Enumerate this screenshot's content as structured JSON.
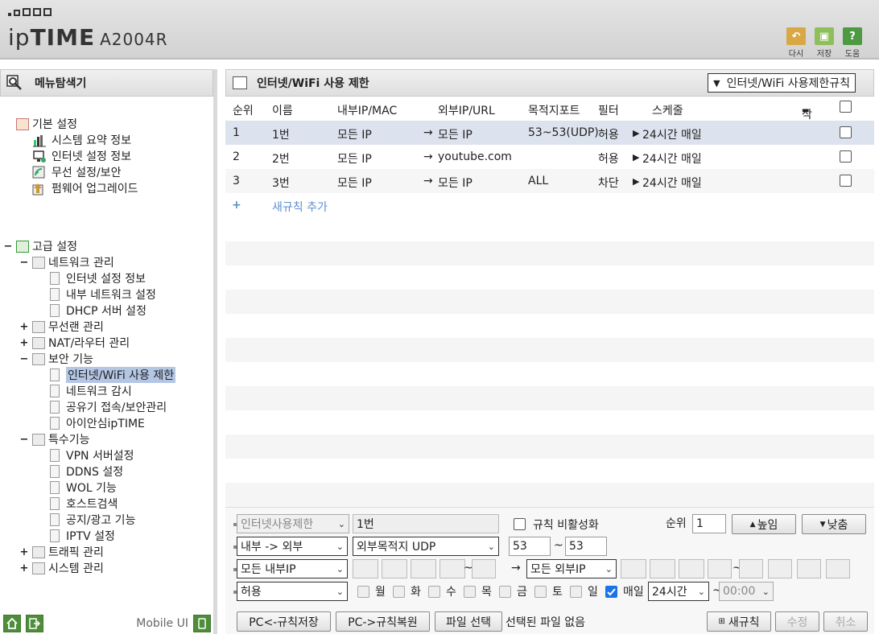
{
  "header": {
    "brand_ip": "ip",
    "brand_time": "TIME",
    "model": "A2004R",
    "buttons": [
      {
        "label": "다시",
        "icon": "undo-icon",
        "glyph": "↶"
      },
      {
        "label": "저장",
        "icon": "save-icon",
        "glyph": "▣"
      },
      {
        "label": "도움",
        "icon": "help-icon",
        "glyph": "?"
      }
    ]
  },
  "sidebar": {
    "title": "메뉴탐색기",
    "basic": {
      "label": "기본 설정",
      "items": [
        "시스템 요약 정보",
        "인터넷 설정 정보",
        "무선 설정/보안",
        "펌웨어 업그레이드"
      ]
    },
    "advanced": {
      "label": "고급 설정",
      "network": {
        "label": "네트워크 관리",
        "items": [
          "인터넷 설정 정보",
          "내부 네트워크 설정",
          "DHCP 서버 설정"
        ]
      },
      "wireless": "무선랜 관리",
      "nat": "NAT/라우터 관리",
      "security": {
        "label": "보안 기능",
        "items": [
          "인터넷/WiFi 사용 제한",
          "네트워크 감시",
          "공유기 접속/보안관리",
          "아이안심ipTIME"
        ]
      },
      "special": {
        "label": "특수기능",
        "items": [
          "VPN 서버설정",
          "DDNS 설정",
          "WOL 기능",
          "호스트검색",
          "공지/광고 기능",
          "IPTV 설정"
        ]
      },
      "traffic": "트래픽 관리",
      "system": "시스템 관리"
    },
    "footer_label": "Mobile UI",
    "toggle_minus": "−",
    "toggle_plus": "+"
  },
  "main": {
    "title": "인터넷/WiFi 사용 제한",
    "rule_select": "인터넷/WiFi 사용제한규칙",
    "columns": {
      "rank": "순위",
      "name": "이름",
      "internal": "내부IP/MAC",
      "external": "외부IP/URL",
      "port": "목적지포트",
      "filter": "필터",
      "schedule": "스케줄",
      "delete": "삭제"
    },
    "rows": [
      {
        "rank": "1",
        "name": "1번",
        "internal": "모든 IP",
        "external": "모든 IP",
        "port": "53~53(UDP)",
        "filter": "허용",
        "schedule": "24시간 매일"
      },
      {
        "rank": "2",
        "name": "2번",
        "internal": "모든 IP",
        "external": "youtube.com",
        "port": "",
        "filter": "허용",
        "schedule": "24시간 매일"
      },
      {
        "rank": "3",
        "name": "3번",
        "internal": "모든 IP",
        "external": "모든 IP",
        "port": "ALL",
        "filter": "차단",
        "schedule": "24시간 매일"
      }
    ],
    "arrow": "→",
    "play": "▶",
    "add_plus": "+",
    "add_rule": "새규칙 추가"
  },
  "form": {
    "type_select": "인터넷사용제한",
    "name_value": "1번",
    "disable_label": "규칙 비활성화",
    "rank_label": "순위",
    "rank_value": "1",
    "up_button": "높임",
    "down_button": "낮춤",
    "direction_select": "내부 -> 외부",
    "port_type_select": "외부목적지 UDP",
    "port_from": "53",
    "port_to": "53",
    "tilde": "~",
    "internal_select": "모든 내부IP",
    "external_select": "모든 외부IP",
    "filter_select": "허용",
    "days": [
      "월",
      "화",
      "수",
      "목",
      "금",
      "토",
      "일"
    ],
    "daily_label": "매일",
    "hours_select": "24시간",
    "time_select": "00:00",
    "buttons": {
      "save_to_pc": "PC<-규칙저장",
      "restore_from_pc": "PC->규칙복원",
      "choose_file": "파일 선택",
      "no_file": "선택된 파일 없음",
      "new_rule": "새규칙",
      "modify": "수정",
      "cancel": "취소"
    }
  }
}
